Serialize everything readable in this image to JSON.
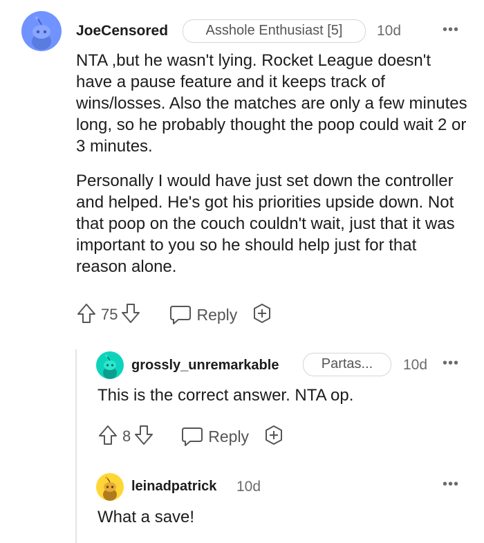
{
  "comments": [
    {
      "username": "JoeCensored",
      "flair": "Asshole Enthusiast [5]",
      "age": "10d",
      "paragraphs": [
        "NTA ,but he wasn't lying. Rocket League doesn't have a pause feature and it keeps track of wins/losses. Also the matches are only a few minutes long, so he probably thought the poop could wait 2 or 3 minutes.",
        "Personally I would have just set down the controller and helped. He's got his priorities upside down. Not that poop on the couch couldn't wait, just that it was important to you so he should help just for that reason alone."
      ],
      "votes": "75",
      "reply_label": "Reply",
      "avatar_color": "#7193ff"
    },
    {
      "username": "grossly_unremarkable",
      "flair": "Partas...",
      "age": "10d",
      "paragraphs": [
        "This is the correct answer. NTA op."
      ],
      "votes": "8",
      "reply_label": "Reply",
      "avatar_color": "#0dd3bb"
    },
    {
      "username": "leinadpatrick",
      "age": "10d",
      "paragraphs": [
        "What a save!"
      ],
      "avatar_color": "#ffd635"
    }
  ],
  "more_label": "•••"
}
